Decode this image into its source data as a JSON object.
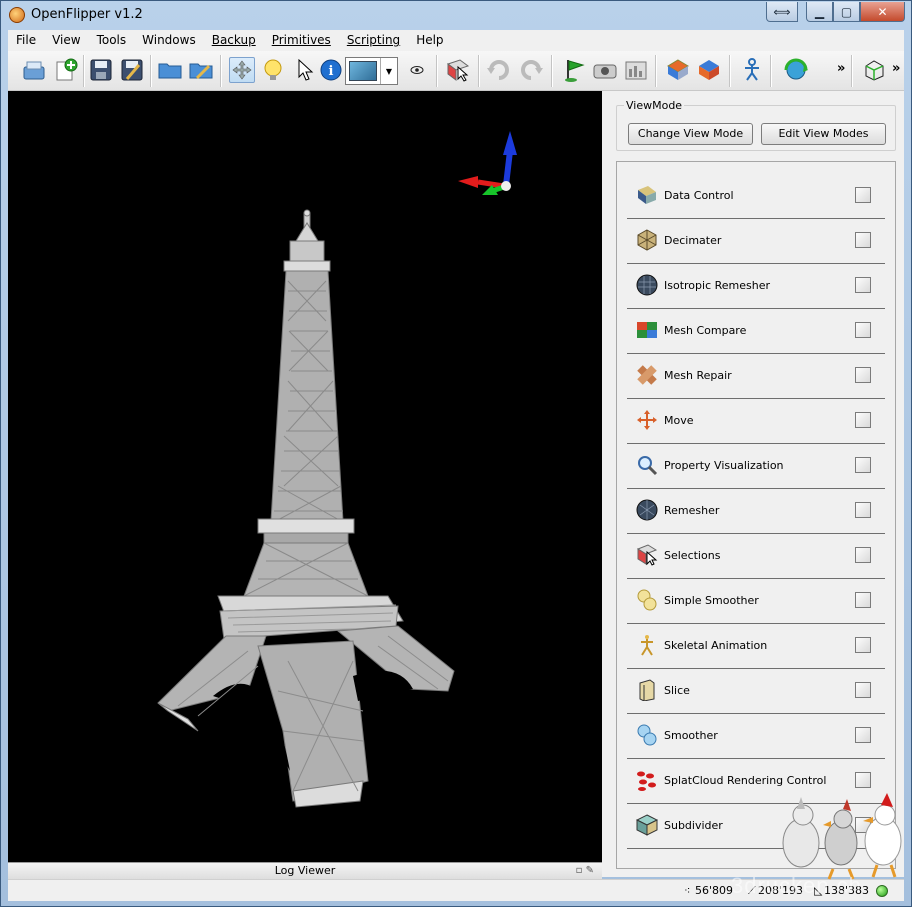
{
  "window": {
    "title": "OpenFlipper v1.2",
    "controls": {
      "resize": "⟺",
      "minimize": "▁",
      "maximize": "▢",
      "close": "✕"
    }
  },
  "menubar": {
    "items": [
      {
        "id": "file",
        "label": "File"
      },
      {
        "id": "view",
        "label": "View"
      },
      {
        "id": "tools",
        "label": "Tools"
      },
      {
        "id": "windows",
        "label": "Windows"
      },
      {
        "id": "backup",
        "label": "Backup"
      },
      {
        "id": "primitives",
        "label": "Primitives"
      },
      {
        "id": "scripting",
        "label": "Scripting"
      },
      {
        "id": "help",
        "label": "Help"
      }
    ]
  },
  "toolbar": {
    "overflow_label": "»",
    "icons": [
      "load-icon",
      "add-empty-object-icon",
      "save-icon",
      "save-as-icon",
      "open-folder-icon",
      "edit-folder-icon",
      "move-mode-icon",
      "light-mode-icon",
      "pick-mode-icon",
      "info-icon",
      "background-color-combo",
      "eye-icon",
      "select-icon",
      "undo-icon",
      "redo-icon",
      "flag-icon",
      "snapshot-icon",
      "screenshot-icon",
      "stereo-icon",
      "stereo-alt-icon",
      "skeleton-icon",
      "rotate-icon",
      "bounding-box-icon"
    ]
  },
  "viewport": {
    "model": "eiffel-tower-mesh"
  },
  "log_viewer": {
    "label": "Log Viewer"
  },
  "viewmode": {
    "title": "ViewMode",
    "change_label": "Change View Mode",
    "edit_label": "Edit View Modes"
  },
  "plugins": [
    {
      "name": "Data Control",
      "icon": "data-control-icon"
    },
    {
      "name": "Decimater",
      "icon": "decimater-icon"
    },
    {
      "name": "Isotropic Remesher",
      "icon": "isotropic-remesher-icon"
    },
    {
      "name": "Mesh Compare",
      "icon": "mesh-compare-icon"
    },
    {
      "name": "Mesh Repair",
      "icon": "mesh-repair-icon"
    },
    {
      "name": "Move",
      "icon": "move-icon"
    },
    {
      "name": "Property Visualization",
      "icon": "magnifier-icon"
    },
    {
      "name": "Remesher",
      "icon": "remesher-icon"
    },
    {
      "name": "Selections",
      "icon": "selections-icon"
    },
    {
      "name": "Simple Smoother",
      "icon": "simple-smoother-icon"
    },
    {
      "name": "Skeletal Animation",
      "icon": "skeletal-animation-icon"
    },
    {
      "name": "Slice",
      "icon": "slice-icon"
    },
    {
      "name": "Smoother",
      "icon": "smoother-icon"
    },
    {
      "name": "SplatCloud Rendering Control",
      "icon": "splatcloud-icon"
    },
    {
      "name": "Subdivider",
      "icon": "subdivider-icon"
    }
  ],
  "statusbar": {
    "vertices": "56'809",
    "edges": "208'193",
    "faces": "138'383"
  },
  "watermark": "3drucken.ch",
  "colors": {
    "title_bar": "#b9d1ea",
    "viewport_bg": "#000000",
    "panel_bg": "#f0f0f0",
    "axis_x": "#e21c1c",
    "axis_y": "#17c42a",
    "axis_z": "#1c3bdc",
    "model": "#b4b4b4"
  }
}
